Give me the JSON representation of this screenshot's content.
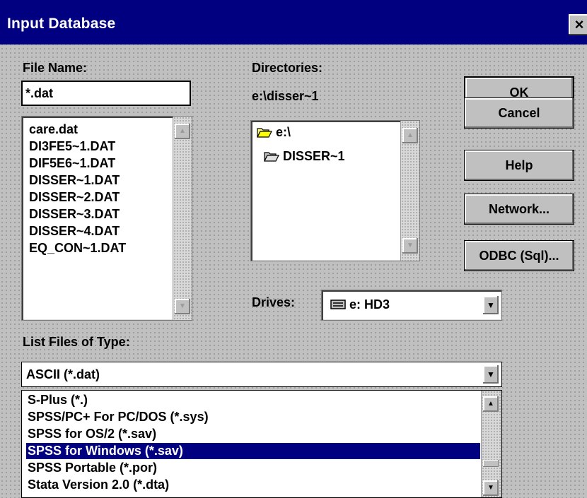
{
  "window": {
    "title": "Input Database",
    "close_label": "×"
  },
  "file_name": {
    "label": "File Name:",
    "value": "*.dat"
  },
  "files": [
    "care.dat",
    "DI3FE5~1.DAT",
    "DIF5E6~1.DAT",
    "DISSER~1.DAT",
    "DISSER~2.DAT",
    "DISSER~3.DAT",
    "DISSER~4.DAT",
    "EQ_CON~1.DAT"
  ],
  "directories": {
    "label": "Directories:",
    "current_path": "e:\\disser~1",
    "items": [
      {
        "label": "e:\\",
        "icon": "open-folder-icon"
      },
      {
        "label": "DISSER~1",
        "icon": "open-folder-icon"
      }
    ]
  },
  "drives": {
    "label": "Drives:",
    "value": "e: HD3",
    "icon": "drive-icon"
  },
  "buttons": {
    "ok": "OK",
    "cancel": "Cancel",
    "help": "Help",
    "network": "Network...",
    "odbc": "ODBC (Sql)..."
  },
  "file_type": {
    "label": "List Files of Type:",
    "value": "ASCII (*.dat)",
    "options": [
      "S-Plus (*.)",
      "SPSS/PC+ For PC/DOS (*.sys)",
      "SPSS for OS/2 (*.sav)",
      "SPSS for Windows (*.sav)",
      "SPSS Portable (*.por)",
      "Stata Version 2.0 (*.dta)"
    ],
    "selected_option": "SPSS for Windows (*.sav)"
  },
  "colors": {
    "titlebar": "#000080",
    "selection": "#000080",
    "face": "#c0c0c0"
  }
}
